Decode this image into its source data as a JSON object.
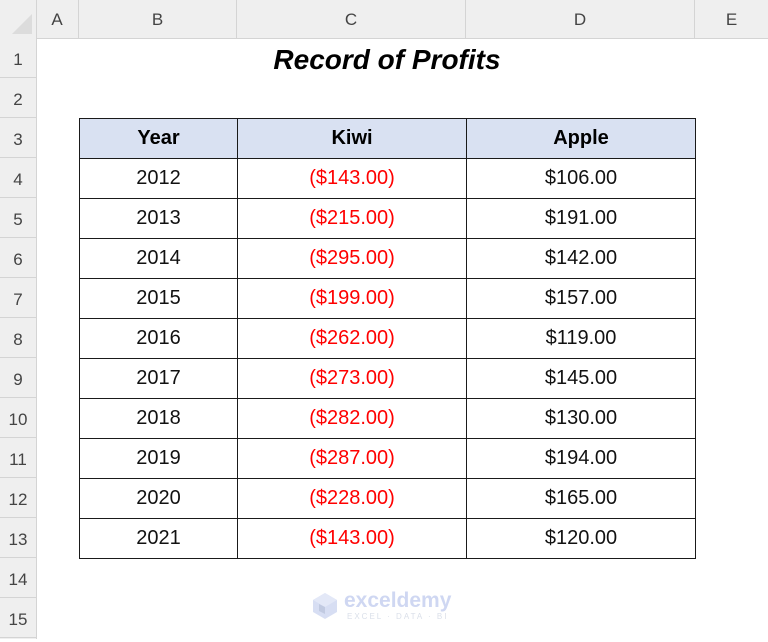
{
  "spreadsheet": {
    "columns": [
      "A",
      "B",
      "C",
      "D",
      "E"
    ],
    "rows": [
      "1",
      "2",
      "3",
      "4",
      "5",
      "6",
      "7",
      "8",
      "9",
      "10",
      "11",
      "12",
      "13",
      "14",
      "15"
    ]
  },
  "title": "Record of Profits",
  "table": {
    "headers": [
      "Year",
      "Kiwi",
      "Apple"
    ],
    "rows": [
      {
        "year": "2012",
        "kiwi": "($143.00)",
        "apple": "$106.00"
      },
      {
        "year": "2013",
        "kiwi": "($215.00)",
        "apple": "$191.00"
      },
      {
        "year": "2014",
        "kiwi": "($295.00)",
        "apple": "$142.00"
      },
      {
        "year": "2015",
        "kiwi": "($199.00)",
        "apple": "$157.00"
      },
      {
        "year": "2016",
        "kiwi": "($262.00)",
        "apple": "$119.00"
      },
      {
        "year": "2017",
        "kiwi": "($273.00)",
        "apple": "$145.00"
      },
      {
        "year": "2018",
        "kiwi": "($282.00)",
        "apple": "$130.00"
      },
      {
        "year": "2019",
        "kiwi": "($287.00)",
        "apple": "$194.00"
      },
      {
        "year": "2020",
        "kiwi": "($228.00)",
        "apple": "$165.00"
      },
      {
        "year": "2021",
        "kiwi": "($143.00)",
        "apple": "$120.00"
      }
    ]
  },
  "colors": {
    "header_fill": "#d9e1f2",
    "negative_text": "#ff0000"
  },
  "watermark": {
    "brand": "exceldemy",
    "tagline": "EXCEL · DATA · BI"
  }
}
